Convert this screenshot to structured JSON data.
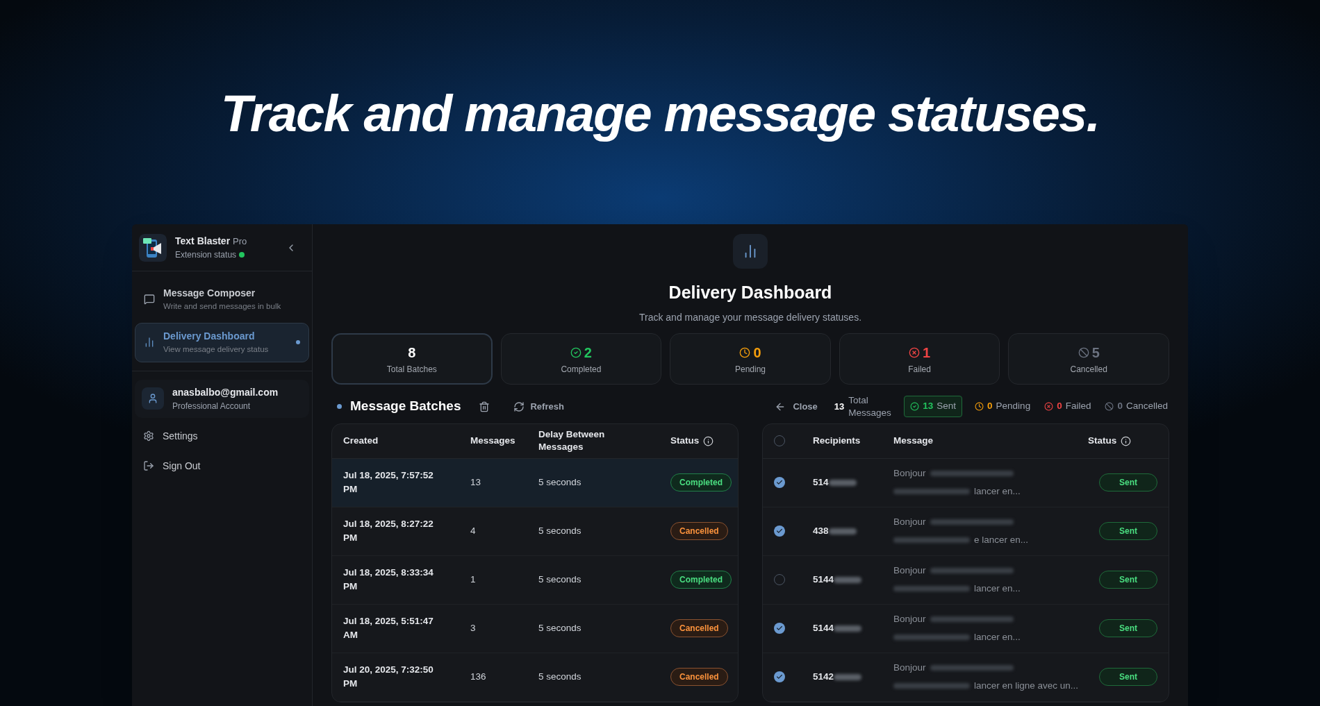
{
  "headline": "Track and manage message statuses.",
  "sidebar": {
    "app_name": "Text Blaster",
    "plan": "Pro",
    "status_label": "Extension status",
    "status_on": true,
    "nav": [
      {
        "kind": "composer",
        "label": "Message Composer",
        "description": "Write and send messages in bulk",
        "selected": false
      },
      {
        "kind": "dashboard",
        "label": "Delivery Dashboard",
        "description": "View message delivery status",
        "selected": true
      }
    ],
    "account": {
      "email": "anasbalbo@gmail.com",
      "type": "Professional Account"
    },
    "links": [
      {
        "kind": "settings",
        "label": "Settings"
      },
      {
        "kind": "signout",
        "label": "Sign Out"
      }
    ]
  },
  "header": {
    "title": "Delivery Dashboard",
    "subtitle": "Track and manage your message delivery statuses."
  },
  "stats": [
    {
      "kind": "total",
      "value": "8",
      "label": "Total Batches",
      "selected": true
    },
    {
      "kind": "completed",
      "value": "2",
      "label": "Completed",
      "selected": false
    },
    {
      "kind": "pending",
      "value": "0",
      "label": "Pending",
      "selected": false
    },
    {
      "kind": "failed",
      "value": "1",
      "label": "Failed",
      "selected": false
    },
    {
      "kind": "cancelled",
      "value": "5",
      "label": "Cancelled",
      "selected": false
    }
  ],
  "batches": {
    "title": "Message Batches",
    "refresh": "Refresh",
    "columns": [
      "Created",
      "Messages",
      "Delay Between Messages",
      "Status"
    ],
    "rows": [
      {
        "created": "Jul 18, 2025, 7:57:52 PM",
        "messages": "13",
        "delay": "5 seconds",
        "status": "Completed",
        "kind": "completed",
        "selected": true
      },
      {
        "created": "Jul 18, 2025, 8:27:22 PM",
        "messages": "4",
        "delay": "5 seconds",
        "status": "Cancelled",
        "kind": "cancelled",
        "selected": false
      },
      {
        "created": "Jul 18, 2025, 8:33:34 PM",
        "messages": "1",
        "delay": "5 seconds",
        "status": "Completed",
        "kind": "completed",
        "selected": false
      },
      {
        "created": "Jul 18, 2025, 5:51:47 AM",
        "messages": "3",
        "delay": "5 seconds",
        "status": "Cancelled",
        "kind": "cancelled",
        "selected": false
      },
      {
        "created": "Jul 20, 2025, 7:32:50 PM",
        "messages": "136",
        "delay": "5 seconds",
        "status": "Cancelled",
        "kind": "cancelled",
        "selected": false
      }
    ]
  },
  "messages": {
    "close": "Close",
    "total": "13",
    "total_label": "Total Messages",
    "counts": [
      {
        "kind": "sent",
        "value": "13",
        "label": "Sent",
        "selected": true
      },
      {
        "kind": "pending",
        "value": "0",
        "label": "Pending",
        "selected": false
      },
      {
        "kind": "failed",
        "value": "0",
        "label": "Failed",
        "selected": false
      },
      {
        "kind": "cancelled",
        "value": "0",
        "label": "Cancelled",
        "selected": false
      }
    ],
    "all_checked": false,
    "columns": [
      "Recipients",
      "Message",
      "Status"
    ],
    "rows": [
      {
        "recipient": "514",
        "message_start": "Bonjour",
        "message_end": "lancer en...",
        "status": "Sent",
        "checked": true
      },
      {
        "recipient": "438",
        "message_start": "Bonjour",
        "message_end": "e lancer en...",
        "status": "Sent",
        "checked": true
      },
      {
        "recipient": "5144",
        "message_start": "Bonjour",
        "message_end": "lancer en...",
        "status": "Sent",
        "checked": false
      },
      {
        "recipient": "5144",
        "message_start": "Bonjour",
        "message_end": "lancer en...",
        "status": "Sent",
        "checked": true
      },
      {
        "recipient": "5142",
        "message_start": "Bonjour",
        "message_end": "lancer en ligne avec un...",
        "status": "Sent",
        "checked": true
      }
    ]
  }
}
